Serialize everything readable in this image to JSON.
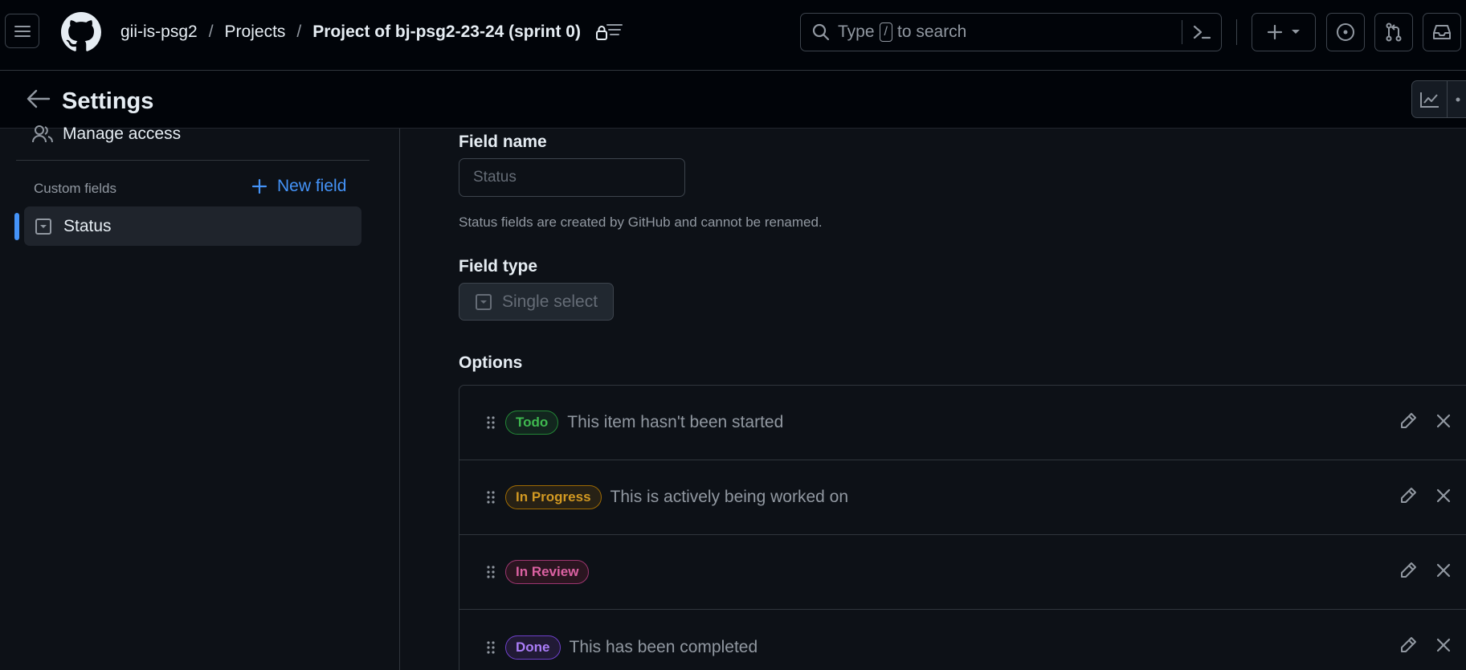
{
  "header": {
    "breadcrumb": {
      "org": "gii-is-psg2",
      "section": "Projects",
      "current": "Project of bj-psg2-23-24 (sprint 0)",
      "separator": "/"
    },
    "search": {
      "prefix": "Type",
      "key": "/",
      "suffix": "to search"
    }
  },
  "settings_bar": {
    "title": "Settings"
  },
  "sidebar": {
    "manage_access": "Manage access",
    "custom_fields_label": "Custom fields",
    "new_field_label": "New field",
    "items": [
      {
        "label": "Status"
      }
    ]
  },
  "main": {
    "field_name_label": "Field name",
    "field_name_placeholder": "Status",
    "field_name_help": "Status fields are created by GitHub and cannot be renamed.",
    "field_type_label": "Field type",
    "field_type_value": "Single select",
    "options_label": "Options",
    "options": [
      {
        "name": "Todo",
        "description": "This item hasn't been started",
        "color": "#3fb950",
        "bg": "#12261e",
        "border": "#238636"
      },
      {
        "name": "In Progress",
        "description": "This is actively being worked on",
        "color": "#d29922",
        "bg": "#272115",
        "border": "#9e6a03"
      },
      {
        "name": "In Review",
        "description": "",
        "color": "#db61a2",
        "bg": "#2a1520",
        "border": "#9e3670"
      },
      {
        "name": "Done",
        "description": "This has been completed",
        "color": "#ab7df8",
        "bg": "#211a35",
        "border": "#6e40c9"
      }
    ]
  },
  "colors": {
    "accent": "#4493f8",
    "background": "#0d1117",
    "header_bg": "#010409",
    "border": "#30363d",
    "muted_text": "#9198a1"
  },
  "icons": [
    "hamburger-icon",
    "github-logo",
    "lock-icon",
    "list-icon",
    "search-icon",
    "terminal-icon",
    "plus-icon",
    "caret-down-icon",
    "issue-icon",
    "pull-request-icon",
    "inbox-icon",
    "arrow-left-icon",
    "graph-icon",
    "kebab-icon",
    "people-icon",
    "single-select-icon",
    "grabber-icon",
    "pencil-icon",
    "x-icon"
  ]
}
